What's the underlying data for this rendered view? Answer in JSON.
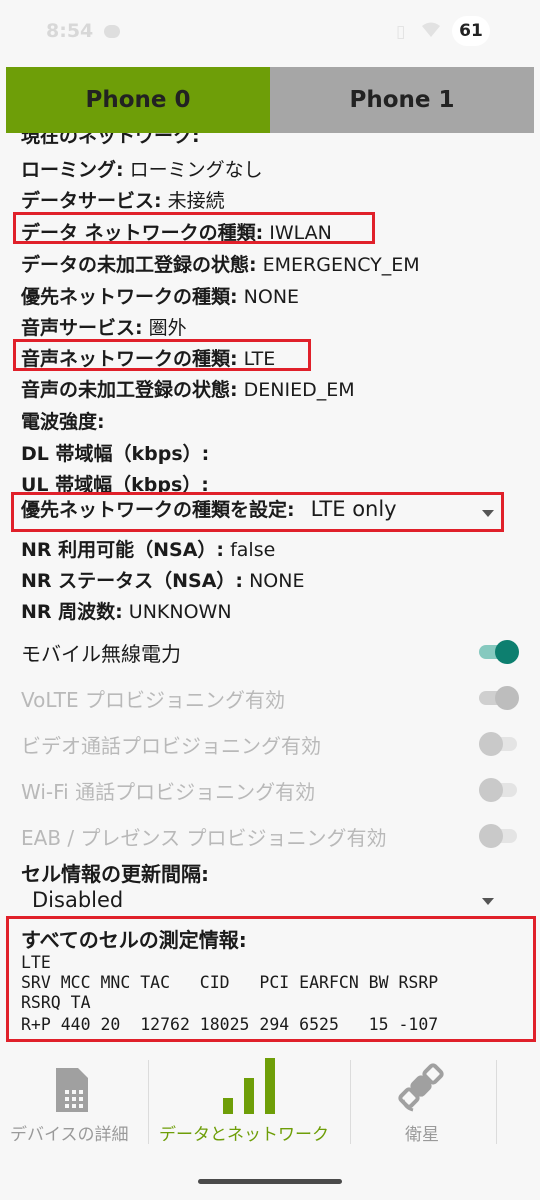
{
  "status_bar": {
    "time": "8:54",
    "battery": "61"
  },
  "phone_tabs": [
    {
      "label": "Phone 0"
    },
    {
      "label": "Phone 1"
    }
  ],
  "cut_off_line": "現在のネットワーク:",
  "info": [
    {
      "label": "ローミング:",
      "value": "ローミングなし"
    },
    {
      "label": "データサービス:",
      "value": "未接続"
    },
    {
      "label": "データ ネットワークの種類:",
      "value": "IWLAN"
    },
    {
      "label": "データの未加工登録の状態:",
      "value": "EMERGENCY_EM"
    },
    {
      "label": "優先ネットワークの種類:",
      "value": "NONE"
    },
    {
      "label": "音声サービス:",
      "value": "圏外"
    },
    {
      "label": "音声ネットワークの種類:",
      "value": "LTE"
    },
    {
      "label": "音声の未加工登録の状態:",
      "value": "DENIED_EM"
    },
    {
      "label": "電波強度:",
      "value": ""
    },
    {
      "label": "DL 帯域幅（kbps）:",
      "value": ""
    },
    {
      "label": "UL 帯域幅（kbps）:",
      "value": ""
    }
  ],
  "preferred_network": {
    "label": "優先ネットワークの種類を設定:",
    "value": "LTE only"
  },
  "nr_info": [
    {
      "label": "NR 利用可能（NSA）:",
      "value": "false"
    },
    {
      "label": "NR ステータス（NSA）:",
      "value": "NONE"
    },
    {
      "label": "NR 周波数:",
      "value": "UNKNOWN"
    }
  ],
  "toggles": [
    {
      "label": "モバイル無線電力",
      "state": "on",
      "enabled": true
    },
    {
      "label": "VoLTE プロビジョニング有効",
      "state": "on",
      "enabled": false
    },
    {
      "label": "ビデオ通話プロビジョニング有効",
      "state": "off",
      "enabled": false
    },
    {
      "label": "Wi-Fi 通話プロビジョニング有効",
      "state": "off",
      "enabled": false
    },
    {
      "label": "EAB / プレゼンス プロビジョニング有効",
      "state": "off",
      "enabled": false
    }
  ],
  "cell_refresh": {
    "label": "セル情報の更新間隔:",
    "value": "Disabled"
  },
  "cell_info": {
    "title": "すべてのセルの測定情報:",
    "lines": [
      "LTE",
      "SRV MCC MNC TAC   CID   PCI EARFCN BW RSRP",
      "RSRQ TA",
      "R+P 440 20  12762 18025 294 6525   15 -107"
    ]
  },
  "bottom_nav": [
    {
      "label": "デバイスの詳細",
      "icon": "sim-card-icon",
      "active": false
    },
    {
      "label": "データとネットワーク",
      "icon": "signal-bars-icon",
      "active": true
    },
    {
      "label": "衛星",
      "icon": "satellite-icon",
      "active": false
    }
  ],
  "colors": {
    "accent_green": "#6e9e08",
    "tab_inactive": "#a6a6a6",
    "highlight_red": "#e0202a",
    "switch_on": "#0d7f6f"
  }
}
